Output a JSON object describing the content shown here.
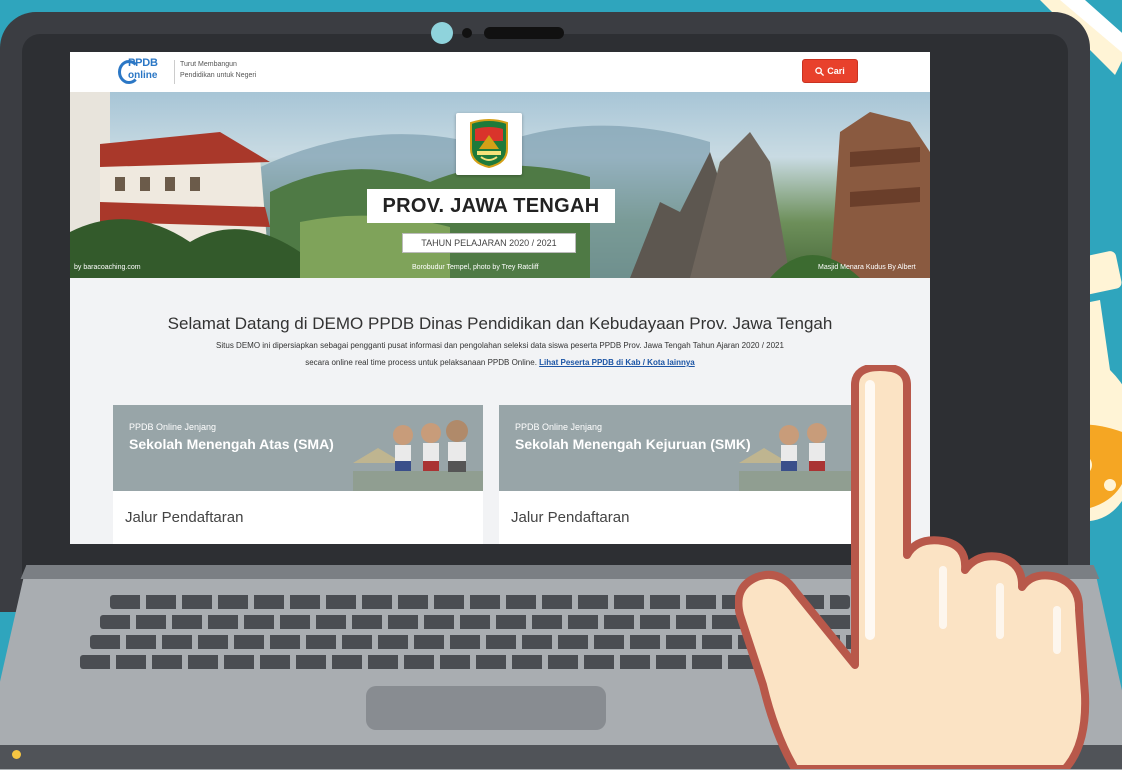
{
  "site": {
    "logo_text": "PPDB",
    "logo_sub": "online",
    "tagline_1": "Turut Membangun",
    "tagline_2": "Pendidikan untuk Negeri",
    "search_label": "Cari"
  },
  "hero": {
    "title": "PROV. JAWA TENGAH",
    "year": "TAHUN PELAJARAN 2020 / 2021",
    "credit_left": "by baracoaching.com",
    "credit_center": "Borobudur Tempel, photo by Trey Ratcliff",
    "credit_right": "Masjid Menara Kudus By Albert"
  },
  "intro": {
    "welcome": "Selamat Datang di DEMO PPDB Dinas Pendidikan dan Kebudayaan Prov. Jawa Tengah",
    "desc_line1": "Situs DEMO ini dipersiapkan sebagai pengganti pusat informasi dan pengolahan seleksi data siswa peserta PPDB Prov. Jawa Tengah Tahun Ajaran 2020 / 2021",
    "desc_line2": "secara online real time process untuk pelaksanaan PPDB Online.",
    "desc_link": "Lihat Peserta PPDB di Kab / Kota lainnya"
  },
  "cards": [
    {
      "small": "PPDB Online Jenjang",
      "title": "Sekolah Menengah Atas (SMA)",
      "body": "Jalur Pendaftaran"
    },
    {
      "small": "PPDB Online Jenjang",
      "title": "Sekolah Menengah Kejuruan (SMK)",
      "body": "Jalur Pendaftaran"
    }
  ],
  "colors": {
    "background": "#2fa5bd",
    "search_button": "#e8412c",
    "card_header": "#98a5a8",
    "link": "#1c55a5",
    "logo": "#2b77c5"
  },
  "icons": [
    "search-icon",
    "province-emblem-icon",
    "pointing-hand-icon",
    "flask-icon",
    "ruler-icon"
  ]
}
